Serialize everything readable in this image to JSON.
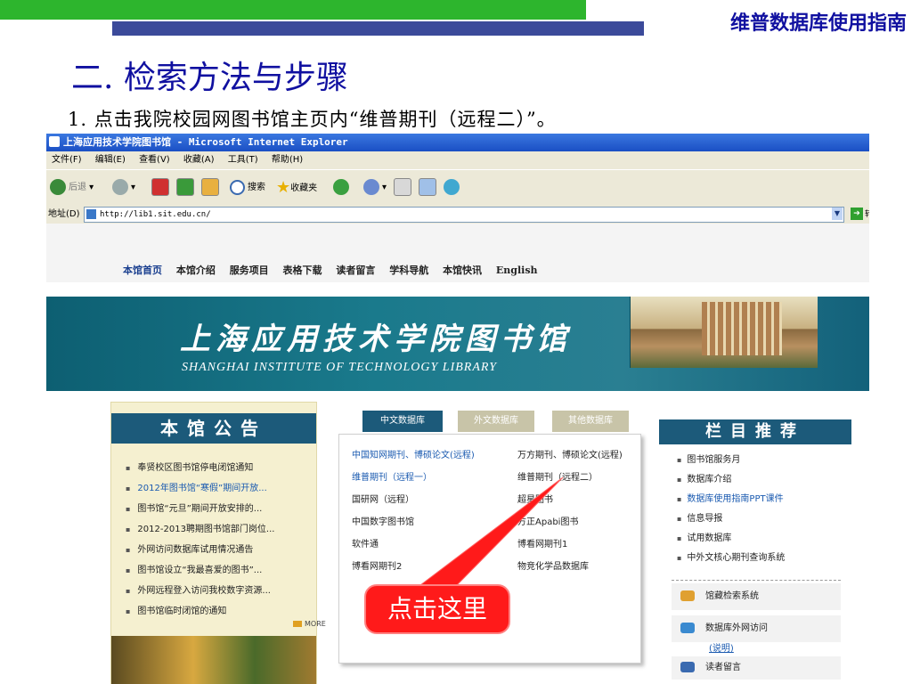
{
  "slide": {
    "header_title": "维普数据库使用指南",
    "section_title": "二. 检索方法与步骤",
    "step_text": "1. 点击我院校园网图书馆主页内“维普期刊（远程二）”。",
    "callout": "点击这里",
    "colors": {
      "green_bar": "#2db52d",
      "blue_bar": "#3b4a9a",
      "title_blue": "#1010a0",
      "callout_red": "#ff1a1a"
    }
  },
  "browser": {
    "title": "上海应用技术学院图书馆 - Microsoft Internet Explorer",
    "menu": [
      "文件(F)",
      "编辑(E)",
      "查看(V)",
      "收藏(A)",
      "工具(T)",
      "帮助(H)"
    ],
    "toolbar": {
      "back": "后退",
      "search": "搜索",
      "favorites": "收藏夹"
    },
    "address_label": "地址(D)",
    "address_value": "http://lib1.sit.edu.cn/",
    "go_label": "转"
  },
  "site": {
    "nav": [
      "本馆首页",
      "本馆介绍",
      "服务项目",
      "表格下载",
      "读者留言",
      "学科导航",
      "本馆快讯",
      "English"
    ],
    "banner_cn": "上海应用技术学院图书馆",
    "banner_en": "SHANGHAI INSTITUTE OF TECHNOLOGY LIBRARY",
    "notice": {
      "heading": "本馆公告",
      "items": [
        "奉贤校区图书馆停电闭馆通知",
        "2012年图书馆“寒假”期间开放...",
        "图书馆“元旦”期间开放安排的...",
        "2012-2013聘期图书馆部门岗位...",
        "外网访问数据库试用情况通告",
        "图书馆设立“我最喜爱的图书”...",
        "外网远程登入访问我校数字资源...",
        "图书馆临时闭馆的通知"
      ],
      "more": "MORE"
    },
    "tabs": [
      "中文数据库",
      "外文数据库",
      "其他数据库"
    ],
    "databases": {
      "left": [
        "中国知网期刊、博硕论文(远程)",
        "维普期刊（远程一）",
        "国研网（远程）",
        "中国数字图书馆",
        "软件通",
        "博看网期刊2"
      ],
      "right": [
        "万方期刊、博硕论文(远程)",
        "维普期刊（远程二）",
        "超星图书",
        "方正Apabi图书",
        "博看网期刊1",
        "物竞化学品数据库"
      ]
    },
    "recommend": {
      "heading": "栏目推荐",
      "items": [
        "图书馆服务月",
        "数据库介绍",
        "数据库使用指南PPT课件",
        "信息导报",
        "试用数据库",
        "中外文核心期刊查询系统"
      ],
      "services": [
        "馆藏检索系统",
        "数据库外网访问",
        "(说明)",
        "读者留言"
      ]
    }
  }
}
